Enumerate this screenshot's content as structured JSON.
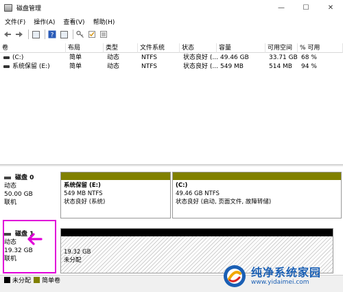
{
  "window": {
    "title": "磁盘管理",
    "controls": [
      "—",
      "☐",
      "✕"
    ]
  },
  "menu": [
    "文件(F)",
    "操作(A)",
    "查看(V)",
    "帮助(H)"
  ],
  "toolbar_icons": [
    "back-arrow-icon",
    "forward-arrow-icon",
    "console-tree-icon",
    "help-icon",
    "properties-icon",
    "key-icon",
    "checklist-icon",
    "list-icon"
  ],
  "volumes": {
    "headers": [
      "卷",
      "布局",
      "类型",
      "文件系统",
      "状态",
      "容量",
      "可用空间",
      "% 可用"
    ],
    "rows": [
      [
        "(C:)",
        "简单",
        "动态",
        "NTFS",
        "状态良好 (...",
        "49.46 GB",
        "33.71 GB",
        "68 %"
      ],
      [
        "系统保留 (E:)",
        "简单",
        "动态",
        "NTFS",
        "状态良好 (...",
        "549 MB",
        "514 MB",
        "94 %"
      ]
    ]
  },
  "disks": [
    {
      "name": "磁盘 0",
      "type": "动态",
      "size": "50.00 GB",
      "status": "联机",
      "partitions": [
        {
          "name": "系统保留  (E:)",
          "size": "549 MB NTFS",
          "status": "状态良好 (系统)",
          "band": "#808000"
        },
        {
          "name": "(C:)",
          "size": "49.46 GB NTFS",
          "status": "状态良好 (启动, 页面文件, 故障转储)",
          "band": "#808000"
        }
      ]
    },
    {
      "name": "磁盘 1",
      "type": "动态",
      "size": "19.32 GB",
      "status": "联机",
      "partitions": [
        {
          "name": "",
          "size": "19.32 GB",
          "status": "未分配",
          "band": "#000000"
        }
      ]
    }
  ],
  "legend": [
    {
      "label": "未分配",
      "color": "#000000"
    },
    {
      "label": "简单卷",
      "color": "#808000"
    }
  ],
  "watermark": {
    "line1": "纯净系统家园",
    "line2": "www.yidaimei.com"
  },
  "colors": {
    "annotation": "#e000d8",
    "simple_volume": "#808000",
    "unallocated": "#000000"
  }
}
